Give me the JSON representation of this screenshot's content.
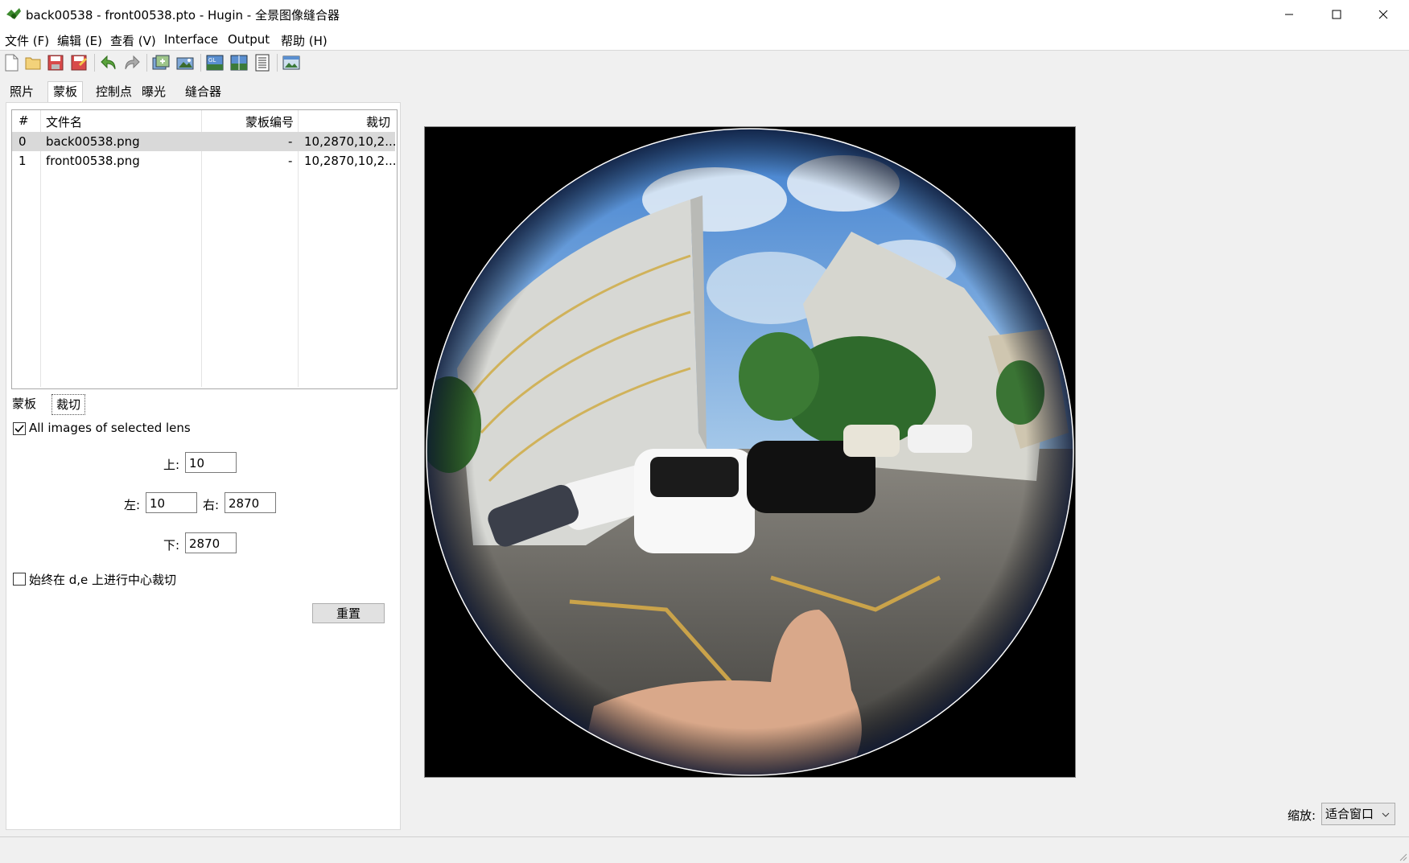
{
  "window": {
    "title": "back00538 - front00538.pto - Hugin - 全景图像缝合器"
  },
  "menu": [
    "文件 (F)",
    "编辑 (E)",
    "查看 (V)",
    "Interface",
    "Output",
    "帮助 (H)"
  ],
  "toolbar_icons": [
    "new-file-icon",
    "open-folder-icon",
    "save-icon",
    "save-as-icon",
    "undo-icon",
    "redo-icon",
    "add-images-icon",
    "add-series-icon",
    "gl-preview-icon",
    "fast-preview-icon",
    "layout-icon",
    "assistant-icon"
  ],
  "tabs": [
    "照片",
    "蒙板",
    "控制点",
    "曝光",
    "缝合器"
  ],
  "active_tab": "蒙板",
  "image_list": {
    "headers": [
      "#",
      "文件名",
      "蒙板编号",
      "裁切"
    ],
    "rows": [
      {
        "index": "0",
        "file": "back00538.png",
        "masks": "-",
        "crop": "10,2870,10,2..."
      },
      {
        "index": "1",
        "file": "front00538.png",
        "masks": "-",
        "crop": "10,2870,10,2..."
      }
    ]
  },
  "subtabs": [
    "蒙板",
    "裁切"
  ],
  "active_subtab": "裁切",
  "crop": {
    "all_images_label": "All images of selected lens",
    "all_images_checked": true,
    "top_label": "上:",
    "top_value": "10",
    "left_label": "左:",
    "left_value": "10",
    "right_label": "右:",
    "right_value": "2870",
    "bottom_label": "下:",
    "bottom_value": "2870",
    "center_crop_label": "始终在 d,e 上进行中心裁切",
    "center_crop_checked": false,
    "reset_label": "重置"
  },
  "zoom": {
    "label": "缩放:",
    "value": "适合窗口"
  },
  "colors": {
    "selected_row": "#d9d9d9",
    "sky": "#6fa4d8",
    "frame": "#000000"
  }
}
